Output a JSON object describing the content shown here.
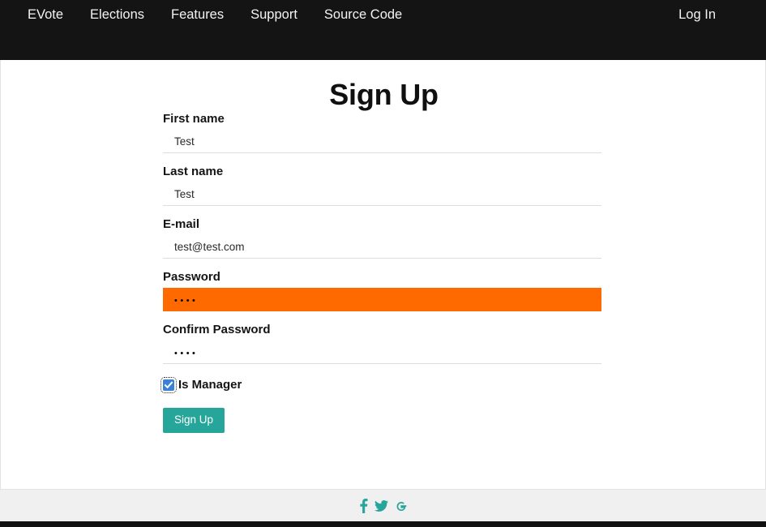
{
  "navbar": {
    "brand": "EVote",
    "links": [
      {
        "label": "EVote",
        "name": "nav-link-evote"
      },
      {
        "label": "Elections",
        "name": "nav-link-elections"
      },
      {
        "label": "Features",
        "name": "nav-link-features"
      },
      {
        "label": "Support",
        "name": "nav-link-support"
      },
      {
        "label": "Source Code",
        "name": "nav-link-source-code"
      }
    ],
    "login_label": "Log In",
    "background_color": "#141414",
    "text_color": "#f3f3f3"
  },
  "main": {
    "title": "Sign Up",
    "form": {
      "fields": [
        {
          "label": "First name",
          "value": "Test",
          "placeholder": "",
          "type": "text",
          "autofilled": false
        },
        {
          "label": "Last name",
          "value": "Test",
          "placeholder": "",
          "type": "text",
          "autofilled": false
        },
        {
          "label": "E-mail",
          "value": "test@test.com",
          "placeholder": "",
          "type": "email",
          "autofilled": false
        },
        {
          "label": "Password",
          "value": "••••",
          "masked_length": 4,
          "placeholder": "",
          "type": "password",
          "autofilled": true
        },
        {
          "label": "Confirm Password",
          "value": "••••",
          "masked_length": 4,
          "placeholder": "",
          "type": "password",
          "autofilled": false
        }
      ],
      "checkbox": {
        "label": "Is Manager",
        "checked": true,
        "color": "#3b82d6"
      },
      "submit_label": "Sign Up",
      "submit_color": "#26a69a",
      "autofill_color": "#ff6a00"
    }
  },
  "footer": {
    "social": [
      {
        "name": "facebook-icon",
        "label": "f"
      },
      {
        "name": "twitter-icon",
        "label": "Twitter"
      },
      {
        "name": "google-icon",
        "label": "G"
      }
    ],
    "icon_color": "#26a69a",
    "background_color": "#f0f0f0",
    "strip_color": "#111111"
  }
}
